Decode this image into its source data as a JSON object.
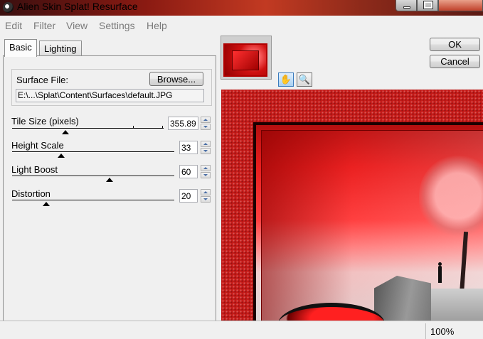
{
  "window": {
    "title": "Alien Skin Splat! Resurface"
  },
  "menu": {
    "items": [
      "Edit",
      "Filter",
      "View",
      "Settings",
      "Help"
    ]
  },
  "tabs": [
    {
      "label": "Basic",
      "active": true
    },
    {
      "label": "Lighting",
      "active": false
    }
  ],
  "surface": {
    "label": "Surface File:",
    "browse_label": "Browse...",
    "path": "E:\\...\\Splat\\Content\\Surfaces\\default.JPG"
  },
  "sliders": [
    {
      "label": "Tile Size (pixels)",
      "value": "355.89",
      "position": 0.26
    },
    {
      "label": "Height Scale",
      "value": "33",
      "position": 0.3
    },
    {
      "label": "Light Boost",
      "value": "60",
      "position": 0.6
    },
    {
      "label": "Distortion",
      "value": "20",
      "position": 0.2
    }
  ],
  "buttons": {
    "ok": "OK",
    "cancel": "Cancel"
  },
  "tools": [
    {
      "name": "hand-tool",
      "active": true
    },
    {
      "name": "zoom-tool",
      "active": false
    }
  ],
  "status": {
    "zoom": "100%"
  }
}
